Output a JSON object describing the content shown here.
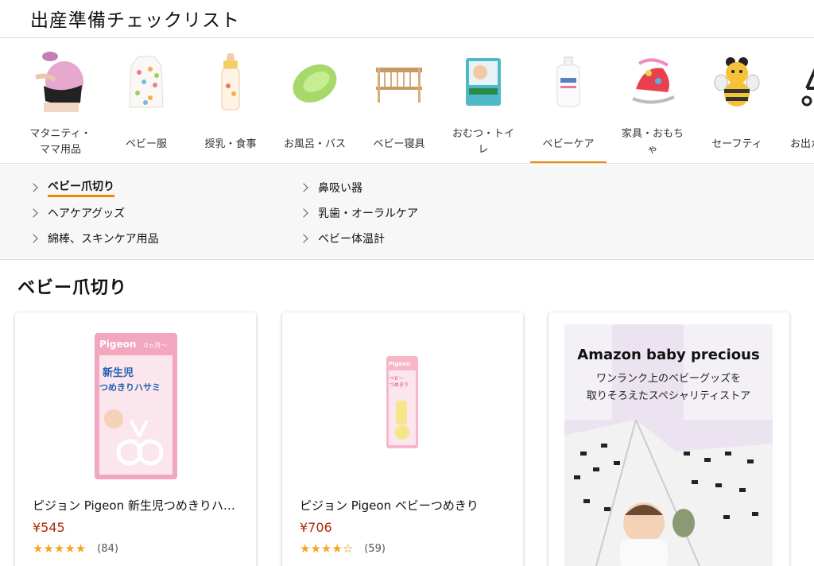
{
  "header": {
    "title": "出産準備チェックリスト"
  },
  "categories": [
    {
      "label_lines": [
        "マタニティ・",
        "ママ用品"
      ],
      "icon": "maternity-belt-icon"
    },
    {
      "label_lines": [
        "ベビー服"
      ],
      "icon": "baby-sleeper-icon"
    },
    {
      "label_lines": [
        "授乳・食事"
      ],
      "icon": "baby-bottle-icon"
    },
    {
      "label_lines": [
        "お風呂・バス"
      ],
      "icon": "baby-bathtub-icon"
    },
    {
      "label_lines": [
        "ベビー寝具"
      ],
      "icon": "baby-crib-icon"
    },
    {
      "label_lines": [
        "おむつ・トイ",
        "レ"
      ],
      "icon": "diaper-pack-icon"
    },
    {
      "label_lines": [
        "ベビーケア"
      ],
      "icon": "lotion-bottle-icon",
      "active": true
    },
    {
      "label_lines": [
        "家具・おもち",
        "ゃ"
      ],
      "icon": "baby-bouncer-icon"
    },
    {
      "label_lines": [
        "セーフティ"
      ],
      "icon": "bee-head-guard-icon"
    },
    {
      "label_lines": [
        "お出か"
      ],
      "icon": "stroller-icon"
    }
  ],
  "subcategories": [
    {
      "label": "ベビー爪切り",
      "active": true
    },
    {
      "label": "鼻吸い器"
    },
    {
      "label": "ヘアケアグッズ"
    },
    {
      "label": "乳歯・オーラルケア"
    },
    {
      "label": "綿棒、スキンケア用品"
    },
    {
      "label": "ベビー体温計"
    }
  ],
  "section": {
    "title": "ベビー爪切り"
  },
  "products": [
    {
      "title": "ピジョン Pigeon 新生児つめきりハサミ",
      "price": "¥545",
      "rating": 5,
      "review_count": "(84)",
      "brand_text": "Pigeon",
      "package_text": [
        "新生児",
        "つめきりハサミ"
      ],
      "age_text": "0ヵ月〜"
    },
    {
      "title": "ピジョン Pigeon ベビーつめきり",
      "price": "¥706",
      "rating": 4,
      "review_count": "(59)",
      "brand_text": "Pigeon",
      "package_text": [
        "ベビー",
        "つめきり"
      ]
    }
  ],
  "banner": {
    "title": "Amazon baby precious",
    "subtitle_lines": [
      "ワンランク上のベビーグッズを",
      "取りそろえたスペシャリティストア"
    ]
  },
  "colors": {
    "accent": "#f08804",
    "price": "#b12704",
    "star": "#f5a623"
  }
}
